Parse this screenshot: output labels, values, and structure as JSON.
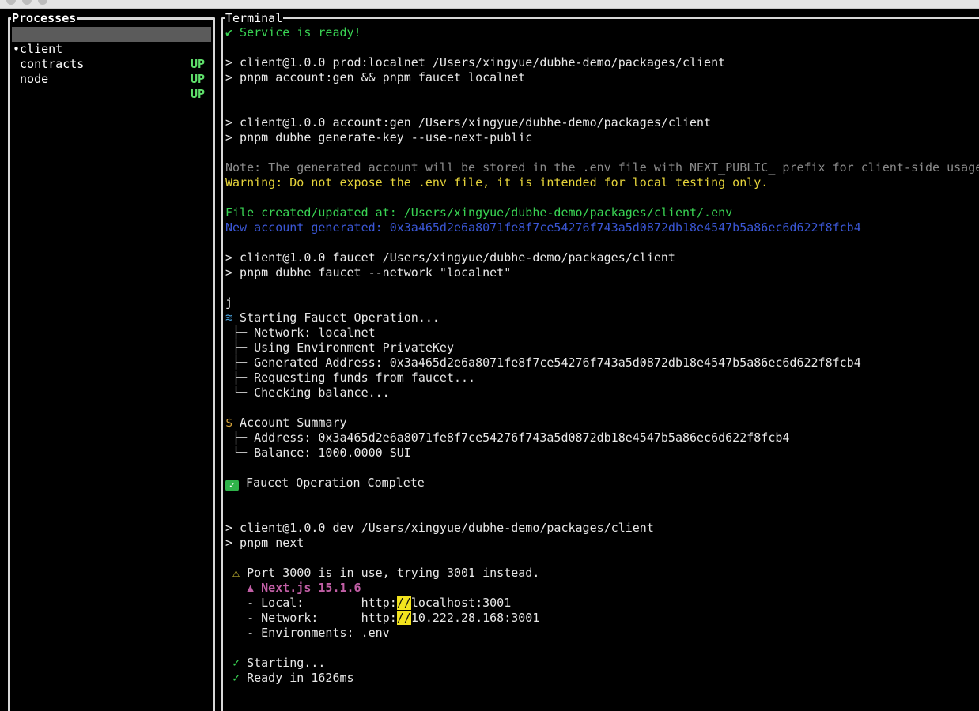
{
  "processes_panel": {
    "title": "Processes",
    "items": [
      {
        "name": "•client",
        "status": "UP"
      },
      {
        "name": " contracts",
        "status": "UP"
      },
      {
        "name": " node",
        "status": "UP"
      }
    ]
  },
  "terminal_panel": {
    "title": "Terminal",
    "lines": {
      "l1": "✔ Service is ready!",
      "l3": "> client@1.0.0 prod:localnet /Users/xingyue/dubhe-demo/packages/client",
      "l4": "> pnpm account:gen && pnpm faucet localnet",
      "l7": "> client@1.0.0 account:gen /Users/xingyue/dubhe-demo/packages/client",
      "l8": "> pnpm dubhe generate-key --use-next-public",
      "l10": "Note: The generated account will be stored in the .env file with NEXT_PUBLIC_ prefix for client-side usage",
      "l11": "Warning: Do not expose the .env file, it is intended for local testing only.",
      "l13": "File created/updated at: /Users/xingyue/dubhe-demo/packages/client/.env",
      "l14": "New account generated: 0x3a465d2e6a8071fe8f7ce54276f743a5d0872db18e4547b5a86ec6d622f8fcb4",
      "l16": "> client@1.0.0 faucet /Users/xingyue/dubhe-demo/packages/client",
      "l17": "> pnpm dubhe faucet --network \"localnet\"",
      "l19": "j",
      "l20": " Starting Faucet Operation...",
      "l21": " ├─ Network: localnet",
      "l22": " ├─ Using Environment PrivateKey",
      "l23": " ├─ Generated Address: 0x3a465d2e6a8071fe8f7ce54276f743a5d0872db18e4547b5a86ec6d622f8fcb4",
      "l24": " ├─ Requesting funds from faucet...",
      "l25": " └─ Checking balance...",
      "l27": " Account Summary",
      "l28": " ├─ Address: 0x3a465d2e6a8071fe8f7ce54276f743a5d0872db18e4547b5a86ec6d622f8fcb4",
      "l29": " └─ Balance: 1000.0000 SUI",
      "l31": " Faucet Operation Complete",
      "l34": "> client@1.0.0 dev /Users/xingyue/dubhe-demo/packages/client",
      "l35": "> pnpm next",
      "l37_icon": "⚠",
      "l37": " Port 3000 is in use, trying 3001 instead.",
      "l38": "   ▲ Next.js 15.1.6",
      "l39a": "   - Local:        http:",
      "l39b": "//",
      "l39c": "localhost:3001",
      "l40a": "   - Network:      http:",
      "l40b": "//",
      "l40c": "10.222.28.168:3001",
      "l41": "   - Environments: .env",
      "l43_icon": "✓",
      "l43": " Starting...",
      "l44_icon": "✓",
      "l44": " Ready in 1626ms"
    }
  },
  "icons": {
    "wave": "wave-icon",
    "money_bag": "money-bag-icon",
    "check_box": "check-mark-button-icon"
  },
  "colors": {
    "status_up": "#5fe06b",
    "success": "#39d353",
    "warning": "#e5d33a",
    "note": "#8a8a8a",
    "account": "#3b57d6",
    "nextjs": "#c25fa6",
    "highlight": "#f2e31e"
  }
}
